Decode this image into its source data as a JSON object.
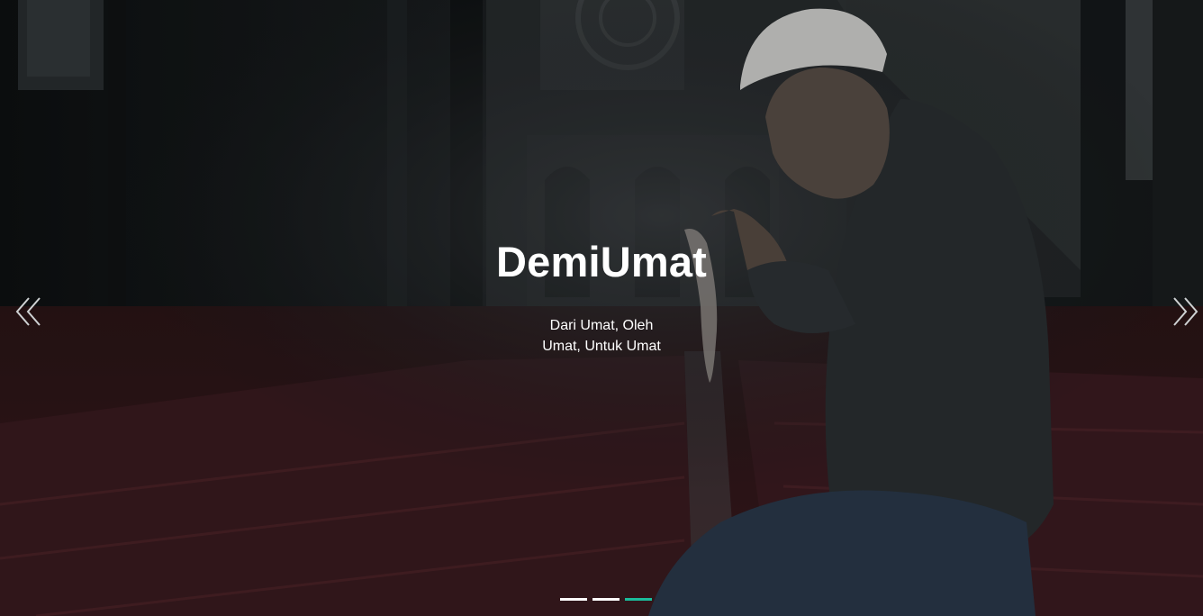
{
  "carousel": {
    "title": "DemiUmat",
    "subtitle": "Dari Umat, Oleh Umat, Untuk Umat",
    "prev_icon": "double-chevron-left-icon",
    "next_icon": "double-chevron-right-icon",
    "slide_count": 3,
    "active_slide_index": 2,
    "indicator_color": "#ffffff",
    "active_indicator_color": "#1bbc9b"
  }
}
